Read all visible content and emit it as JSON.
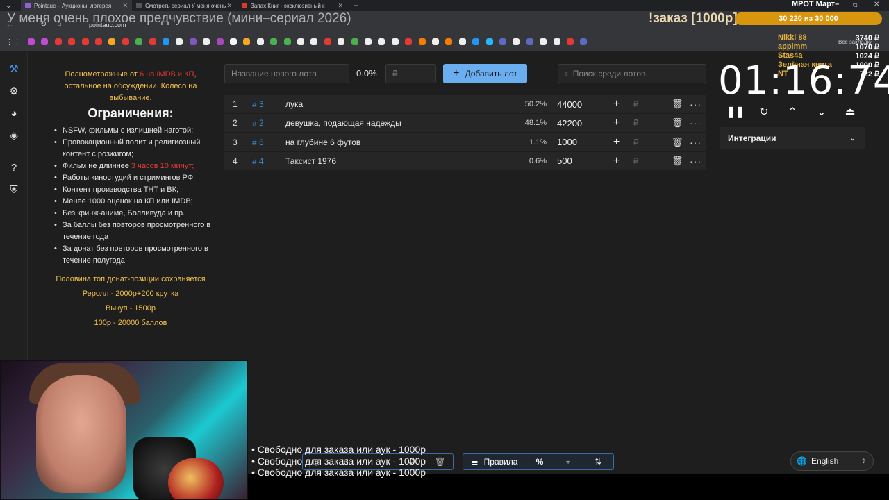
{
  "browser": {
    "tabs": [
      {
        "title": "Pointauc – Аукционы, лотерея",
        "color": "#8e63d6"
      },
      {
        "title": "Смотреть сериал У меня очень",
        "color": "#555555"
      },
      {
        "title": "Запах Книг - эксклюзивный к",
        "color": "#d93b2b"
      }
    ],
    "url": "pointauc.com",
    "new_tab": "+",
    "bookmarks_label": "Все закладки"
  },
  "stream": {
    "overlay_title": "У меня очень плохое предчувствие (мини–сериал 2026)",
    "order_text": "!заказ [1000р]",
    "goal_text": "30 220  из 30 000",
    "mrot": "МРОТ Март–",
    "donors": [
      {
        "name": "Nikki 88",
        "amount": "3740 ₽"
      },
      {
        "name": "appimm",
        "amount": "1070 ₽"
      },
      {
        "name": "Stas4a",
        "amount": "1024 ₽"
      },
      {
        "name": "Зелёная книга",
        "amount": "1000 ₽"
      },
      {
        "name": "NT",
        "amount": "722 ₽"
      }
    ],
    "feed": [
      "• Свободно для заказа или аук - 1000р",
      "• Свободно для заказа или аук - 1000р",
      "• Свободно для заказа или аук - 1000р"
    ]
  },
  "rules": {
    "intro_a": "Полнометражные от ",
    "intro_red": "6 на IMDB и КП",
    "intro_b": ", остальное на обсуждении. Колесо на выбывание.",
    "heading": "Ограничения:",
    "items": [
      "NSFW, фильмы с излишней наготой;",
      "Провокационный полит и религиозный контент с розжигом;",
      "Работы киностудий и стримингов РФ",
      "Контент производства ТНТ и ВК;",
      "Менее 1000 оценок на КП или IMDB;",
      "Без кринж-аниме, Болливуда и пр.",
      "За баллы без повторов просмотренного в течение года",
      "За донат без повторов просмотренного в течение полугода"
    ],
    "film_a": "Фильм не длиннее ",
    "film_red": "3 часов 10 минут;",
    "foot": [
      "Половина топ донат-позиции сохраняется",
      "Реролл - 2000р+200 крутка",
      "Выкуп - 1500р",
      "100р - 20000 баллов"
    ]
  },
  "lot_form": {
    "name_placeholder": "Название нового лота",
    "percent": "0.0%",
    "amount_placeholder": "₽",
    "add_label": "Добавить лот",
    "search_placeholder": "Поиск среди лотов..."
  },
  "lots": [
    {
      "num": "1",
      "id": "# 3",
      "name": "лука",
      "pct": "50.2%",
      "amount": "44000"
    },
    {
      "num": "2",
      "id": "# 2",
      "name": "девушка, подающая надежды",
      "pct": "48.1%",
      "amount": "42200"
    },
    {
      "num": "3",
      "id": "# 6",
      "name": "на глубине 6 футов",
      "pct": "1.1%",
      "amount": "1000"
    },
    {
      "num": "4",
      "id": "# 4",
      "name": "Таксист 1976",
      "pct": "0.6%",
      "amount": "500"
    }
  ],
  "row_icons": {
    "plus": "+",
    "rub": "₽",
    "trash": "🗑",
    "more": "···"
  },
  "timer": {
    "value": "01:16:74",
    "controls": [
      "pause-icon",
      "reset-icon",
      "chevron-up-icon",
      "chevron-down-icon",
      "eject-icon"
    ]
  },
  "integrations": {
    "label": "Интеграции"
  },
  "bottom": {
    "rules_label": "Правила",
    "percent_icon": "%",
    "language": "English"
  }
}
